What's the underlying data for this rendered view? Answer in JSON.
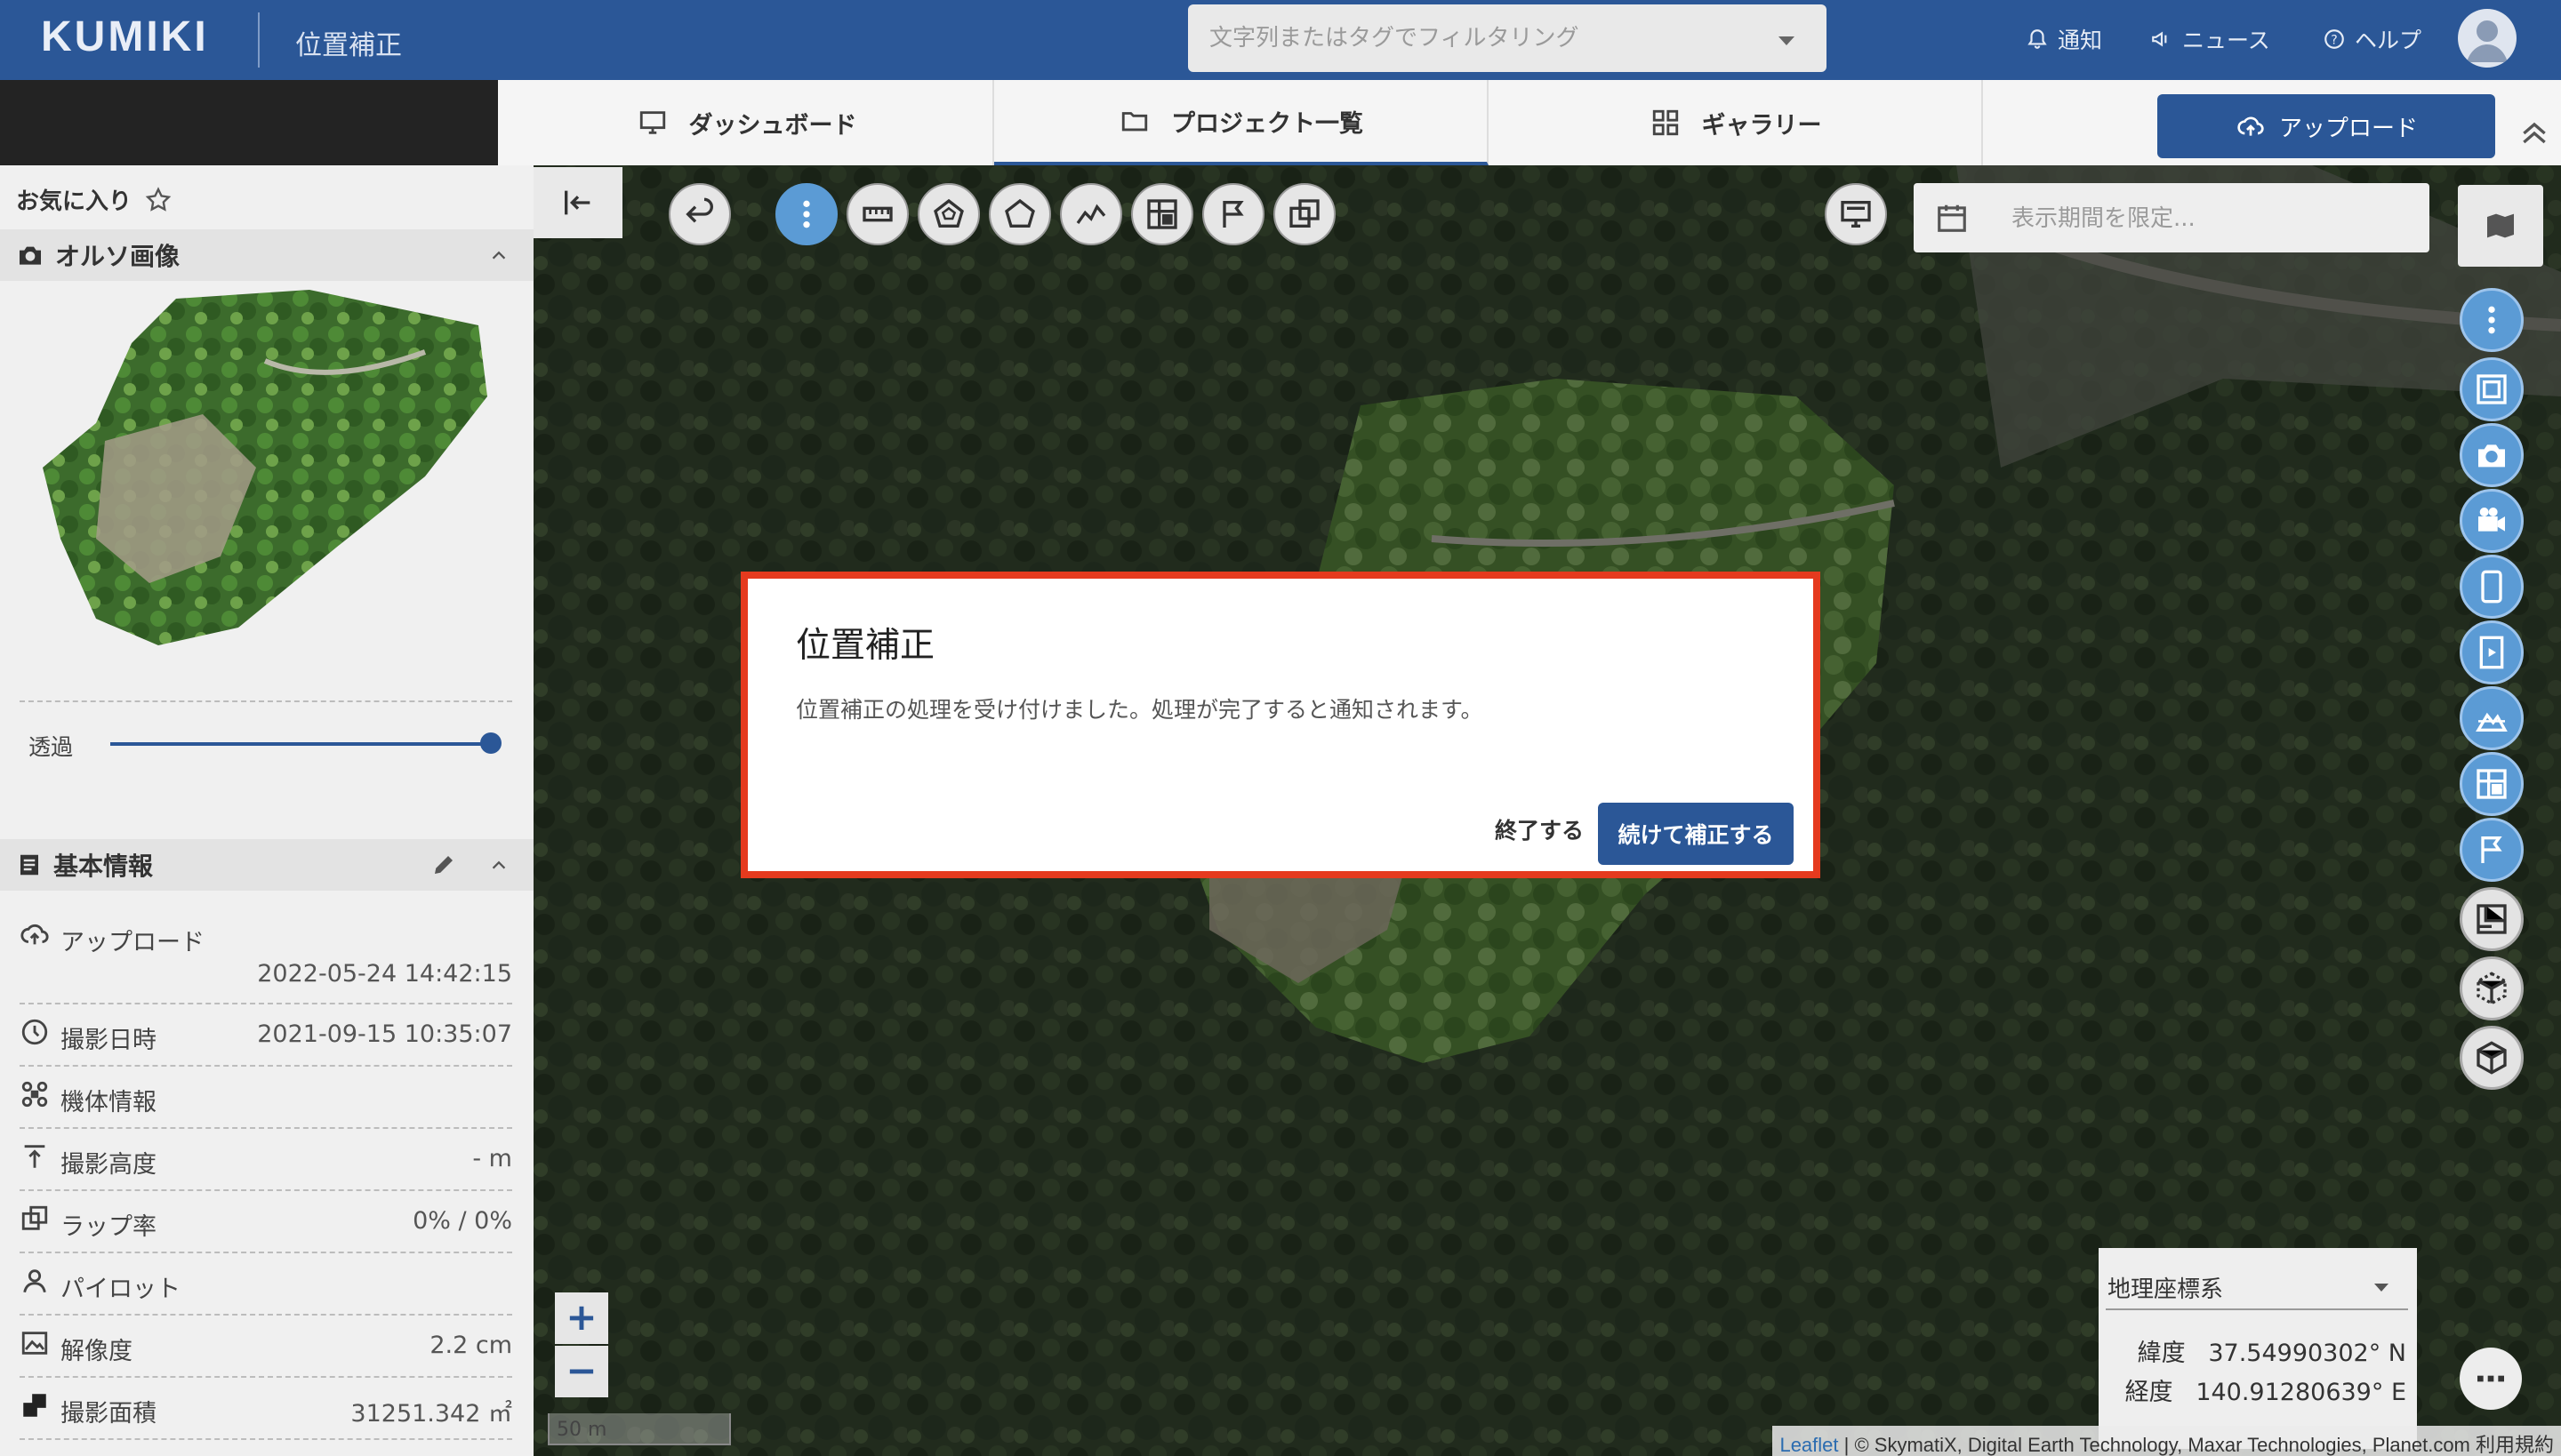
{
  "header": {
    "logo": "KUMIKI",
    "page_title": "位置補正",
    "filter_placeholder": "文字列またはタグでフィルタリング",
    "notify_label": "通知",
    "news_label": "ニュース",
    "help_label": "ヘルプ"
  },
  "tabs": [
    {
      "label": "ダッシュボード",
      "icon": "monitor-icon"
    },
    {
      "label": "プロジェクト一覧",
      "icon": "folder-icon",
      "active": true
    },
    {
      "label": "ギャラリー",
      "icon": "grid-icon"
    }
  ],
  "upload_label": "アップロード",
  "sidebar": {
    "favorites_label": "お気に入り",
    "ortho_section": "オルソ画像",
    "opacity_label": "透過",
    "opacity_value": 1.0,
    "basic_section": "基本情報",
    "info": [
      {
        "label": "アップロード",
        "value": "2022-05-24 14:42:15",
        "icon": "upload-icon"
      },
      {
        "label": "撮影日時",
        "value": "2021-09-15 10:35:07",
        "icon": "clock-icon"
      },
      {
        "label": "機体情報",
        "value": "",
        "icon": "drone-icon"
      },
      {
        "label": "撮影高度",
        "value": "- m",
        "icon": "altitude-icon"
      },
      {
        "label": "ラップ率",
        "value": "0% / 0%",
        "icon": "overlap-icon"
      },
      {
        "label": "パイロット",
        "value": "",
        "icon": "person-icon"
      },
      {
        "label": "解像度",
        "value": "2.2 cm",
        "icon": "image-icon"
      },
      {
        "label": "撮影面積",
        "value": "31251.342 ㎡",
        "icon": "area-icon"
      }
    ]
  },
  "map": {
    "period_placeholder": "表示期間を限定...",
    "scale_label": "50 m",
    "coord_system": "地理座標系",
    "lat_label": "緯度",
    "lat_value": "37.54990302° N",
    "lon_label": "経度",
    "lon_value": "140.91280639° E",
    "attribution_link": "Leaflet",
    "attribution_text": " | © SkymatiX, Digital Earth Technology, Maxar Technologies, Planet.com 利用規約",
    "zoom_in": "+",
    "zoom_out": "−"
  },
  "dialog": {
    "title": "位置補正",
    "message": "位置補正の処理を受け付けました。処理が完了すると通知されます。",
    "end_label": "終了する",
    "continue_label": "続けて補正する"
  },
  "colors": {
    "brand": "#2b5797",
    "accent_tool": "#5b9bd5",
    "highlight_border": "#e53a1e"
  }
}
